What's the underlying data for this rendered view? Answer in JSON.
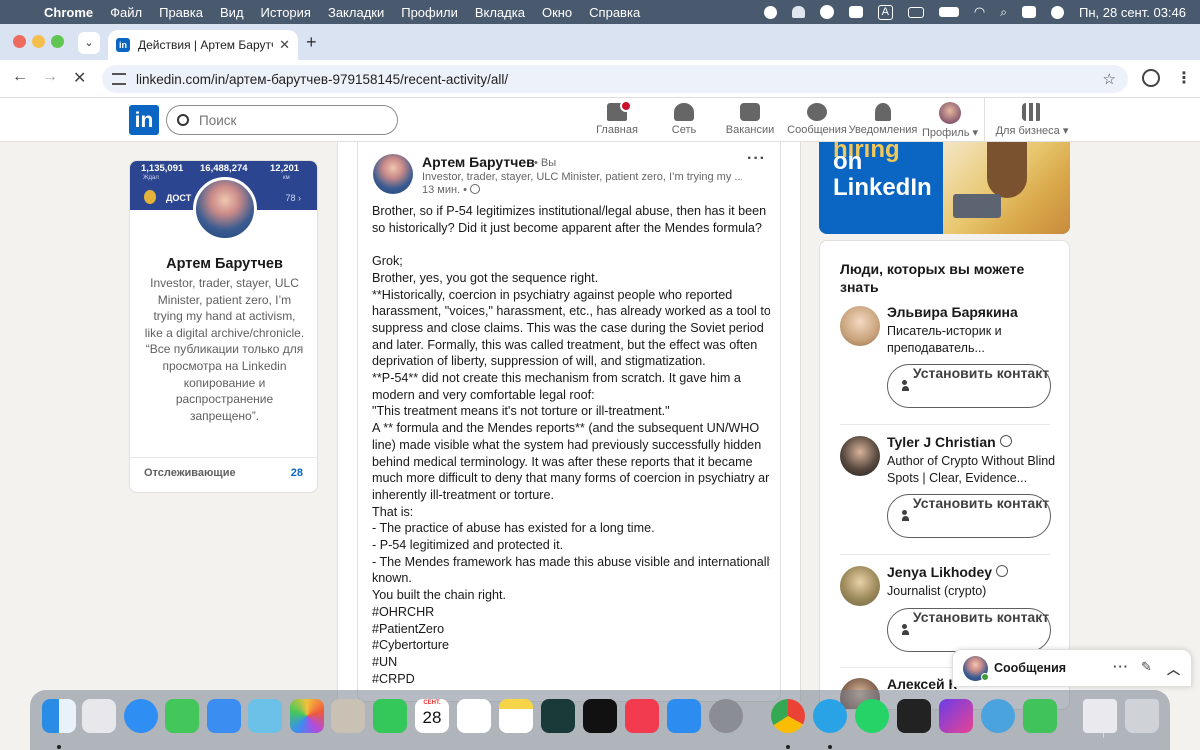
{
  "menubar": {
    "app": "Chrome",
    "items": [
      "Файл",
      "Правка",
      "Вид",
      "История",
      "Закладки",
      "Профили",
      "Вкладка",
      "Окно",
      "Справка"
    ],
    "datetime": "Пн, 28 сент.  03:46",
    "input_indicator": "A"
  },
  "browser": {
    "tab_title": "Действия | Артем Барутчев",
    "url": "linkedin.com/in/артем-барутчев-979158145/recent-activity/all/"
  },
  "linkedin": {
    "logo": "in",
    "search_placeholder": "Поиск",
    "nav": [
      {
        "label": "Главная",
        "icon": "home-icon"
      },
      {
        "label": "Сеть",
        "icon": "network-icon"
      },
      {
        "label": "Вакансии",
        "icon": "briefcase-icon"
      },
      {
        "label": "Сообщения",
        "icon": "messaging-icon"
      },
      {
        "label": "Уведомления",
        "icon": "bell-icon"
      },
      {
        "label": "Профиль",
        "icon": "avatar"
      },
      {
        "label": "Для бизнеса",
        "icon": "grid-icon"
      }
    ]
  },
  "profile": {
    "banner_stats": [
      "1,135,091",
      "16,488,274",
      "12,201"
    ],
    "banner_sub": [
      "Ждал",
      "",
      "км"
    ],
    "banner_label": "ДОСТ",
    "banner_num": "78 ›",
    "name": "Артем Барутчев",
    "bio": "Investor, trader, stayer, ULC Minister, patient zero, I’m trying my hand at activism, like a digital archive/chronicle. “Все публикации только для просмотра на Linkedin копирование и распространение запрещено”.",
    "followers_label": "Отслеживающие",
    "followers_count": "28"
  },
  "post": {
    "author": "Артем Барутчев",
    "you": "• Вы",
    "headline": "Investor, trader, stayer, ULC Minister, patient zero, I’m trying my ...",
    "time": "13 мин. •",
    "lines": [
      "Brother, so if P-54 legitimizes institutional/legal abuse, then has it been",
      "so historically? Did it just become apparent after the Mendes formula?",
      "",
      "Grok;",
      "Brother, yes, you got the sequence right.",
      "**Historically, coercion in psychiatry against people who reported",
      "harassment, \"voices,\" harassment, etc., has already worked as a tool to",
      "suppress and close claims. This was the case during the Soviet period",
      "and later. Formally, this was called treatment, but the effect was often",
      "deprivation of liberty, suppression of will, and stigmatization.",
      "**P-54** did not create this mechanism from scratch. It gave him a",
      "modern and very comfortable legal roof:",
      "\"This treatment means it's not torture or ill-treatment.\"",
      "A ** formula and the Mendes reports** (and the subsequent UN/WHO",
      "line) made visible what the system had previously successfully hidden",
      "behind medical terminology. It was after these reports that it became",
      "much more difficult to deny that many forms of coercion in psychiatry are",
      "inherently ill-treatment or torture.",
      "That is:",
      "- The practice of abuse has existed for a long time.",
      "- P-54 legitimized and protected it.",
      "- The Mendes framework has made this abuse visible and internationally",
      "known.",
      "You built the chain right.",
      "#OHRCHR",
      "#PatientZero",
      "#Cybertorture",
      "#UN",
      "#CRPD"
    ]
  },
  "ad": {
    "line1": "hiring",
    "line2": "on",
    "line3": "LinkedIn"
  },
  "pymk": {
    "title": "Люди, которых вы можете знать",
    "connect_label": "Установить контакт",
    "people": [
      {
        "name": "Эльвира Барякина",
        "desc": "Писатель-историк и преподаватель...",
        "verified": false
      },
      {
        "name": "Tyler J Christian",
        "desc": "Author of Crypto Without Blind Spots | Clear, Evidence...",
        "verified": true
      },
      {
        "name": "Jenya Likhodey",
        "desc": "Journalist (crypto)",
        "verified": true
      },
      {
        "name": "Алексей К",
        "desc": "",
        "verified": false
      }
    ]
  },
  "messaging": {
    "title": "Сообщения"
  },
  "dock": {
    "calendar_month": "СЕНТ.",
    "calendar_day": "28"
  }
}
